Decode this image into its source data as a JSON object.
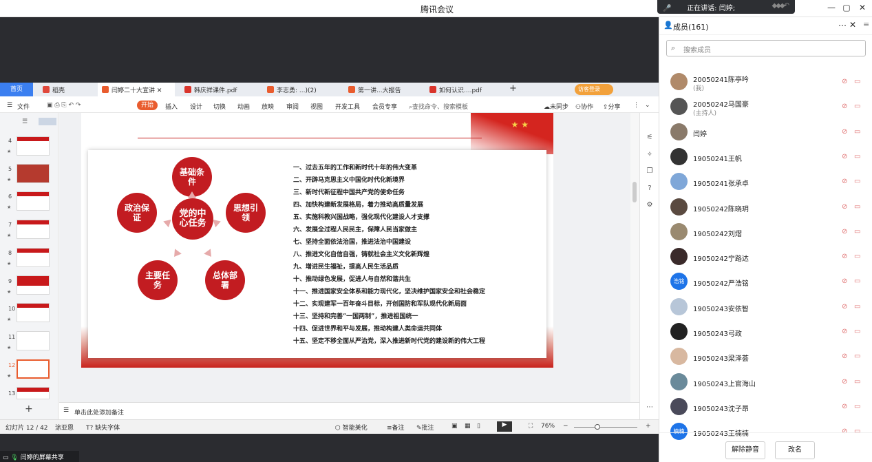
{
  "window": {
    "title": "腾讯会议"
  },
  "speaking": {
    "label": "正在讲话: 闫婷;"
  },
  "tabs": [
    {
      "label": "首页"
    },
    {
      "label": "稻壳",
      "color": "#e0483b"
    },
    {
      "label": "闫婷二十大宣讲",
      "color": "#e95c2e"
    },
    {
      "label": "韩庆祥课件.pdf",
      "color": "#d9342b"
    },
    {
      "label": "李志勇: ...)(2)",
      "color": "#e95c2e"
    },
    {
      "label": "第一讲...大报告",
      "color": "#e95c2e"
    },
    {
      "label": "如何认识....pdf",
      "color": "#d9342b"
    }
  ],
  "login": "访客登录",
  "menu": {
    "file": "文件",
    "start": "开始",
    "items": [
      "插入",
      "设计",
      "切换",
      "动画",
      "放映",
      "审阅",
      "视图",
      "开发工具",
      "会员专享"
    ],
    "search": "查找命令、搜索模板",
    "sync": "未同步",
    "collab": "协作",
    "share": "分享"
  },
  "thumbs": [
    {
      "num": "4"
    },
    {
      "num": "5"
    },
    {
      "num": "6"
    },
    {
      "num": "7"
    },
    {
      "num": "8"
    },
    {
      "num": "9"
    },
    {
      "num": "10"
    },
    {
      "num": "11"
    },
    {
      "num": "12"
    },
    {
      "num": "13"
    }
  ],
  "slide": {
    "center": "党的中心任务",
    "nodes": [
      "基础条件",
      "思想引领",
      "总体部署",
      "主要任务",
      "政治保证"
    ],
    "items": [
      "一、过去五年的工作和新时代十年的伟大变革",
      "二、开辟马克思主义中国化时代化新境界",
      "三、新时代新征程中国共产党的使命任务",
      "四、加快构建新发展格局，着力推动高质量发展",
      "五、实施科教兴国战略，强化现代化建设人才支撑",
      "六、发展全过程人民民主，保障人民当家做主",
      "七、坚持全面依法治国，推进法治中国建设",
      "八、推进文化自信自强，铸就社会主义文化新辉煌",
      "九、增进民生福祉，提高人民生活品质",
      "十、推动绿色发展，促进人与自然和谐共生",
      "十一、推进国家安全体系和能力现代化，坚决维护国家安全和社会稳定",
      "十二、实现建军一百年奋斗目标，开创国防和军队现代化新局面",
      "十三、坚持和完善“一国两制”，推进祖国统一",
      "十四、促进世界和平与发展，推动构建人类命运共同体",
      "十五、坚定不移全面从严治党，深入推进新时代党的建设新的伟大工程"
    ]
  },
  "notes": "单击此处添加备注",
  "status": {
    "slide": "幻灯片 12 / 42",
    "theme": "涂亚恩",
    "font": "缺失字体",
    "beautify": "智能美化",
    "notes": "备注",
    "comment": "批注",
    "zoom": "76%"
  },
  "share_label": "闫婷的屏幕共享",
  "members": {
    "title": "成员(161)",
    "search_placeholder": "搜索成员",
    "list": [
      {
        "name": "20050241陈亭吟",
        "sub": "(我)",
        "color": "#b08a6a"
      },
      {
        "name": "20050242马国豪",
        "sub": "(主持人)",
        "color": "#555555"
      },
      {
        "name": "闫婷",
        "sub": "",
        "color": "#8a7a6a"
      },
      {
        "name": "19050241王帆",
        "sub": "",
        "color": "#333333"
      },
      {
        "name": "19050241张承卓",
        "sub": "",
        "color": "#7fa7d8"
      },
      {
        "name": "19050242陈晓玥",
        "sub": "",
        "color": "#5a4a40"
      },
      {
        "name": "19050242刘熠",
        "sub": "",
        "color": "#9a8a70"
      },
      {
        "name": "19050242宁路达",
        "sub": "",
        "color": "#3a2a2a"
      },
      {
        "name": "19050242严浩铭",
        "sub": "",
        "color": "#1e74e8",
        "avatar_text": "浩铭"
      },
      {
        "name": "19050243安依智",
        "sub": "",
        "color": "#b7c6d8"
      },
      {
        "name": "19050243弓政",
        "sub": "",
        "color": "#222222"
      },
      {
        "name": "19050243梁泽荟",
        "sub": "",
        "color": "#d8b8a0"
      },
      {
        "name": "19050243上官海山",
        "sub": "",
        "color": "#6a8a9a"
      },
      {
        "name": "19050243沈子昂",
        "sub": "",
        "color": "#4a4a5a"
      },
      {
        "name": "19050243王楠楠",
        "sub": "",
        "color": "#1e74e8",
        "avatar_text": "楠楠"
      }
    ],
    "unmute": "解除静音",
    "rename": "改名"
  }
}
